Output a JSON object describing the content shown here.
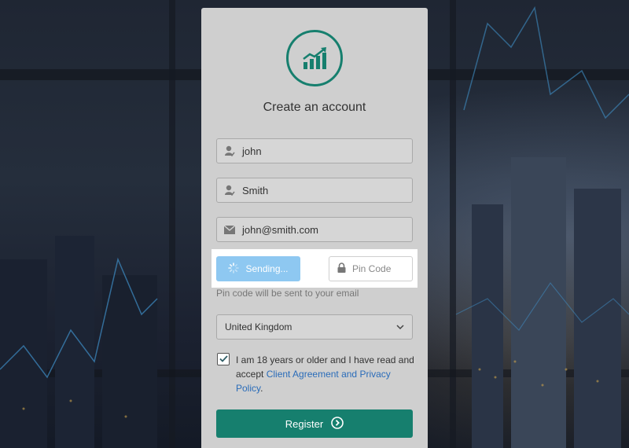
{
  "form": {
    "title": "Create an account",
    "first_name": "john",
    "last_name": "Smith",
    "email": "john@smith.com",
    "send_button": "Sending...",
    "pin_placeholder": "Pin Code",
    "pin_hint": "Pin code will be sent to your email",
    "country": "United Kingdom",
    "agreement_text": "I am 18 years or older and I have read and accept ",
    "agreement_link": "Client Agreement and Privacy Policy",
    "agreement_end": ".",
    "register_button": "Register",
    "agreement_checked": true
  },
  "colors": {
    "accent": "#167f6e",
    "send_button": "#8ec8f1",
    "link": "#2a6cb9"
  },
  "icons": [
    "chart-logo-icon",
    "user-icon",
    "envelope-icon",
    "spinner-icon",
    "lock-icon",
    "chevron-down-icon",
    "checkmark-icon",
    "arrow-right-circle-icon"
  ]
}
